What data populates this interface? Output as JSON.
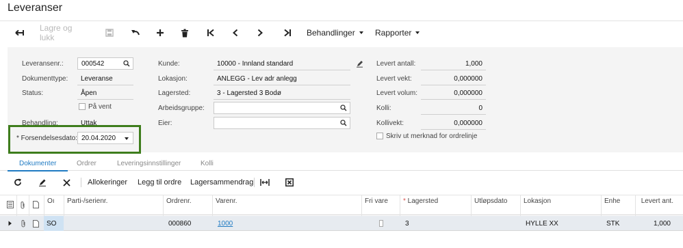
{
  "page": {
    "title": "Leveranser"
  },
  "toolbar": {
    "save_close_label": "Lagre og lukk",
    "actions_label": "Behandlinger",
    "reports_label": "Rapporter"
  },
  "form": {
    "shipment_nbr": {
      "label": "Leveransenr.:",
      "value": "000542"
    },
    "doc_type": {
      "label": "Dokumenttype:",
      "value": "Leveranse"
    },
    "status": {
      "label": "Status:",
      "value": "Åpen"
    },
    "hold": {
      "label": "På vent",
      "checked": false
    },
    "operation": {
      "label": "Behandling:",
      "value": "Uttak"
    },
    "ship_date": {
      "label": "* Forsendelsesdato:",
      "value": "20.04.2020"
    },
    "customer": {
      "label": "Kunde:",
      "value": "10000 - Innland standard"
    },
    "location": {
      "label": "Lokasjon:",
      "value": "ANLEGG - Lev adr anlegg"
    },
    "warehouse": {
      "label": "Lagersted:",
      "value": "3 - Lagersted 3 Bodø"
    },
    "workgroup": {
      "label": "Arbeidsgruppe:",
      "value": ""
    },
    "owner": {
      "label": "Eier:",
      "value": ""
    },
    "shipped_qty": {
      "label": "Levert antall:",
      "value": "1,000"
    },
    "shipped_weight": {
      "label": "Levert vekt:",
      "value": "0,000000"
    },
    "shipped_volume": {
      "label": "Levert volum:",
      "value": "0,000000"
    },
    "packages": {
      "label": "Kolli:",
      "value": "0"
    },
    "package_weight": {
      "label": "Kollivekt:",
      "value": "0,000000"
    },
    "print_note": {
      "label": "Skriv ut merknad for ordrelinje",
      "checked": false
    }
  },
  "tabs": [
    {
      "label": "Dokumenter",
      "active": true
    },
    {
      "label": "Ordrer",
      "active": false
    },
    {
      "label": "Leveringsinnstillinger",
      "active": false
    },
    {
      "label": "Kolli",
      "active": false
    }
  ],
  "grid_toolbar": {
    "allocations": "Allokeringer",
    "add_order": "Legg til ordre",
    "inventory_summary": "Lagersammendrag"
  },
  "grid": {
    "columns": {
      "order_type": "Oı",
      "lot_serial": "Parti-/serienr.",
      "order_nbr": "Ordrenr.",
      "inventory_id": "Varenr.",
      "free_item": "Fri vare",
      "warehouse": "Lagersted",
      "expiry": "Utløpsdato",
      "location": "Lokasjon",
      "uom": "Enhe",
      "shipped_qty": "Levert ant."
    },
    "rows": [
      {
        "order_type": "SO",
        "lot_serial": "",
        "order_nbr": "000860",
        "inventory_id": "1000",
        "free_item": false,
        "warehouse": "3",
        "expiry": "",
        "location": "HYLLE XX",
        "uom": "STK",
        "shipped_qty": "1,000"
      }
    ]
  },
  "icons": {
    "back": "arrow-left-icon",
    "save": "floppy-icon",
    "undo": "undo-icon",
    "add": "plus-icon",
    "delete": "trash-icon",
    "first": "first-icon",
    "prev": "prev-icon",
    "next": "next-icon",
    "last": "last-icon"
  }
}
